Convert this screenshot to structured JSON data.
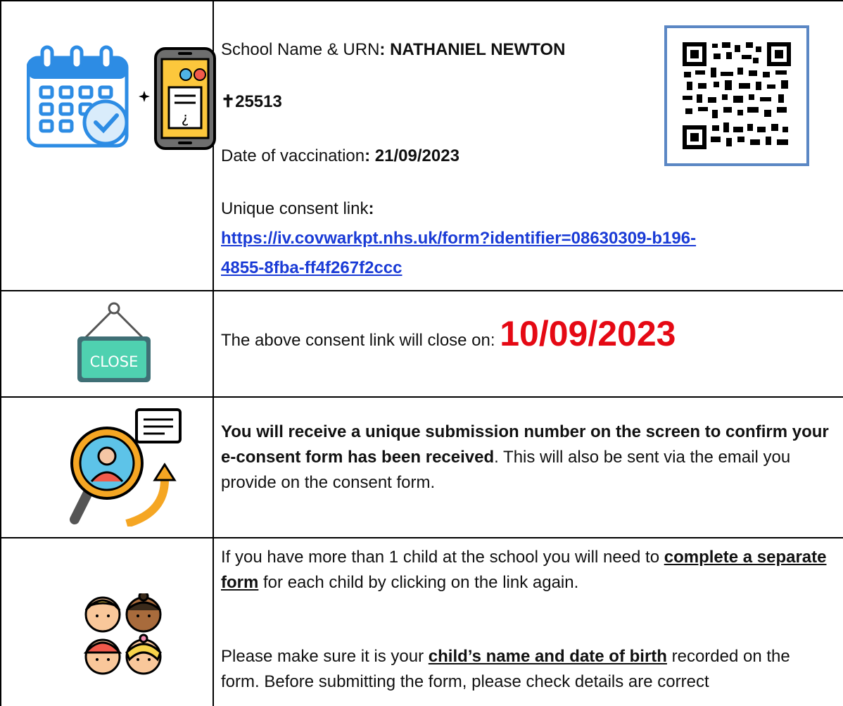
{
  "row1": {
    "school_label": "School Name & URN",
    "school_name": "NATHANIEL NEWTON",
    "urn": "25513",
    "date_label": "Date of vaccination",
    "date_value": "21/09/2023",
    "link_label": "Unique consent link",
    "link_line1": "https://iv.covwarkpt.nhs.uk/form?identifier=08630309-b196-",
    "link_line2": "4855-8fba-ff4f267f2ccc",
    "icons": [
      "calendar-check-icon",
      "mobile-form-icon",
      "qr-code-icon"
    ]
  },
  "row2": {
    "text": "The above consent link will close on:",
    "close_date": "10/09/2023",
    "sign_text": "CLOSE",
    "icon": "close-sign-icon"
  },
  "row3": {
    "bold_text": "You will receive a unique submission number on the screen to confirm your e-consent form has been received",
    "rest_text": ". This will also be sent via the email you provide on the consent form.",
    "icon": "search-user-icon"
  },
  "row4": {
    "p1_a": "If you have more than 1 child at the school you will need to ",
    "p1_u": "complete a separate form",
    "p1_b": " for each child by clicking on the link again.",
    "p2_a": "Please make sure it is your ",
    "p2_u": "child’s name and date of birth",
    "p2_b": " recorded on the form. Before submitting the form, please check details are correct",
    "icon": "children-icon"
  },
  "colors": {
    "link": "#1a3bd6",
    "close_date": "#e50914",
    "border": "#000000"
  }
}
